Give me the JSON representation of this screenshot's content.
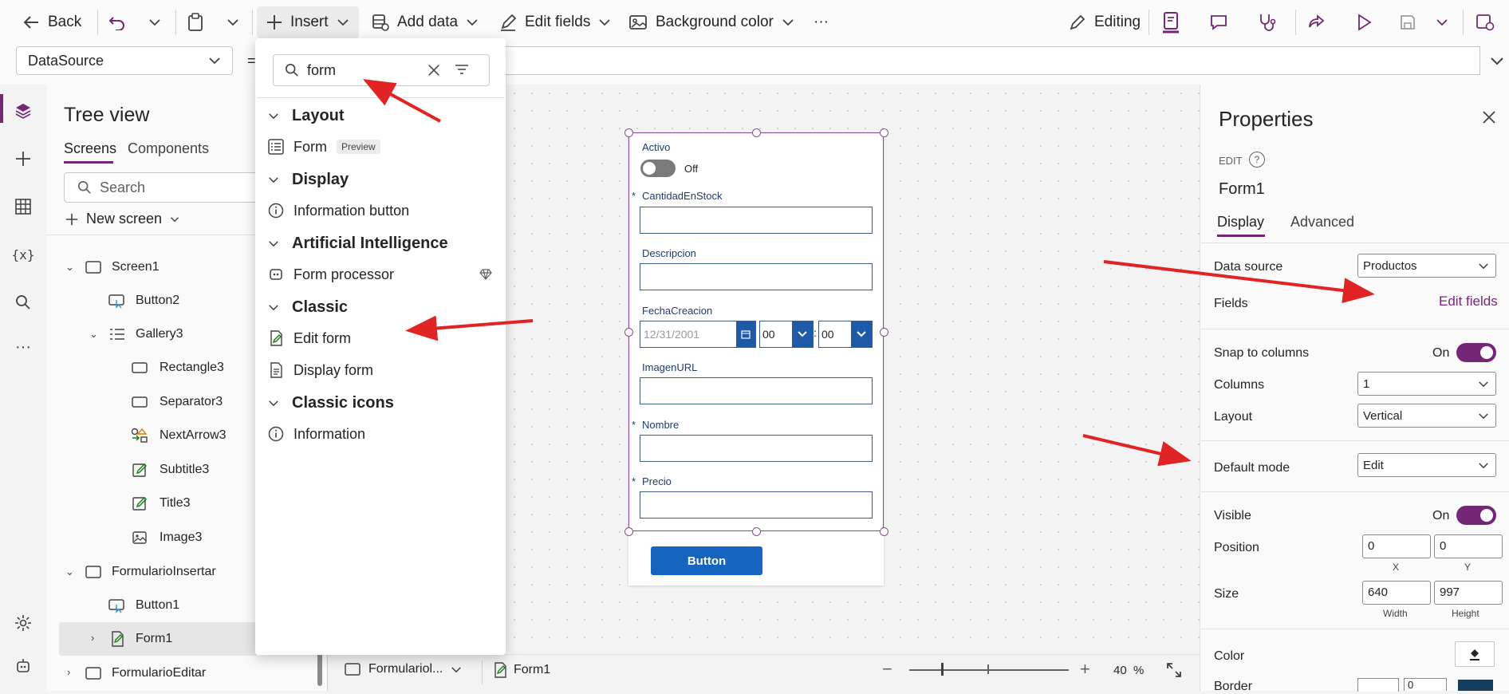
{
  "toolbar": {
    "back": "Back",
    "insert": "Insert",
    "add_data": "Add data",
    "edit_fields": "Edit fields",
    "background_color": "Background color",
    "more": "···",
    "editing": "Editing"
  },
  "formula_bar": {
    "property": "DataSource",
    "equals": "="
  },
  "tree_view": {
    "title": "Tree view",
    "tabs": [
      "Screens",
      "Components"
    ],
    "search_placeholder": "Search",
    "new_screen": "New screen",
    "items": [
      {
        "label": "Screen1",
        "icon": "screen-icon"
      },
      {
        "label": "Button2",
        "icon": "button-icon"
      },
      {
        "label": "Gallery3",
        "icon": "gallery-icon"
      },
      {
        "label": "Rectangle3",
        "icon": "rectangle-icon"
      },
      {
        "label": "Separator3",
        "icon": "rectangle-icon"
      },
      {
        "label": "NextArrow3",
        "icon": "shapes-icon"
      },
      {
        "label": "Subtitle3",
        "icon": "edit-label-icon"
      },
      {
        "label": "Title3",
        "icon": "edit-label-icon"
      },
      {
        "label": "Image3",
        "icon": "image-icon"
      },
      {
        "label": "FormularioInsertar",
        "icon": "screen-icon"
      },
      {
        "label": "Button1",
        "icon": "button-icon"
      },
      {
        "label": "Form1",
        "icon": "form-icon"
      },
      {
        "label": "FormularioEditar",
        "icon": "screen-icon"
      }
    ]
  },
  "insert_panel": {
    "search_value": "form",
    "categories": {
      "layout": "Layout",
      "display": "Display",
      "ai": "Artificial Intelligence",
      "classic": "Classic",
      "classic_icons": "Classic icons"
    },
    "items": {
      "form": "Form",
      "preview": "Preview",
      "information_button": "Information button",
      "form_processor": "Form processor",
      "edit_form": "Edit form",
      "display_form": "Display form",
      "information": "Information"
    }
  },
  "form": {
    "activo_label": "Activo",
    "activo_toggle": "Off",
    "cantidad_label": "CantidadEnStock",
    "descripcion_label": "Descripcion",
    "fecha_label": "FechaCreacion",
    "fecha_value": "12/31/2001",
    "hour_value": "00",
    "minute_value": "00",
    "imagen_label": "ImagenURL",
    "nombre_label": "Nombre",
    "precio_label": "Precio",
    "required_mark": "*",
    "button_label": "Button"
  },
  "bottom_bar": {
    "screen_name": "Formulariol...",
    "control_name": "Form1",
    "zoom_value": "40",
    "zoom_unit": "%"
  },
  "properties": {
    "title": "Properties",
    "mode_label": "EDIT",
    "control_name": "Form1",
    "tabs": [
      "Display",
      "Advanced"
    ],
    "data_source_label": "Data source",
    "data_source_value": "Productos",
    "fields_label": "Fields",
    "edit_fields_link": "Edit fields",
    "snap_label": "Snap to columns",
    "snap_value": "On",
    "columns_label": "Columns",
    "columns_value": "1",
    "layout_label": "Layout",
    "layout_value": "Vertical",
    "default_mode_label": "Default mode",
    "default_mode_value": "Edit",
    "visible_label": "Visible",
    "visible_value": "On",
    "position_label": "Position",
    "position_x": "0",
    "position_y": "0",
    "x_label": "X",
    "y_label": "Y",
    "size_label": "Size",
    "size_width": "640",
    "size_height": "997",
    "width_label": "Width",
    "height_label": "Height",
    "color_label": "Color",
    "border_label": "Border",
    "border_value": "0"
  },
  "colors": {
    "accent_purple": "#742774",
    "button_blue": "#1565c0",
    "annotation_red": "#e02424"
  }
}
